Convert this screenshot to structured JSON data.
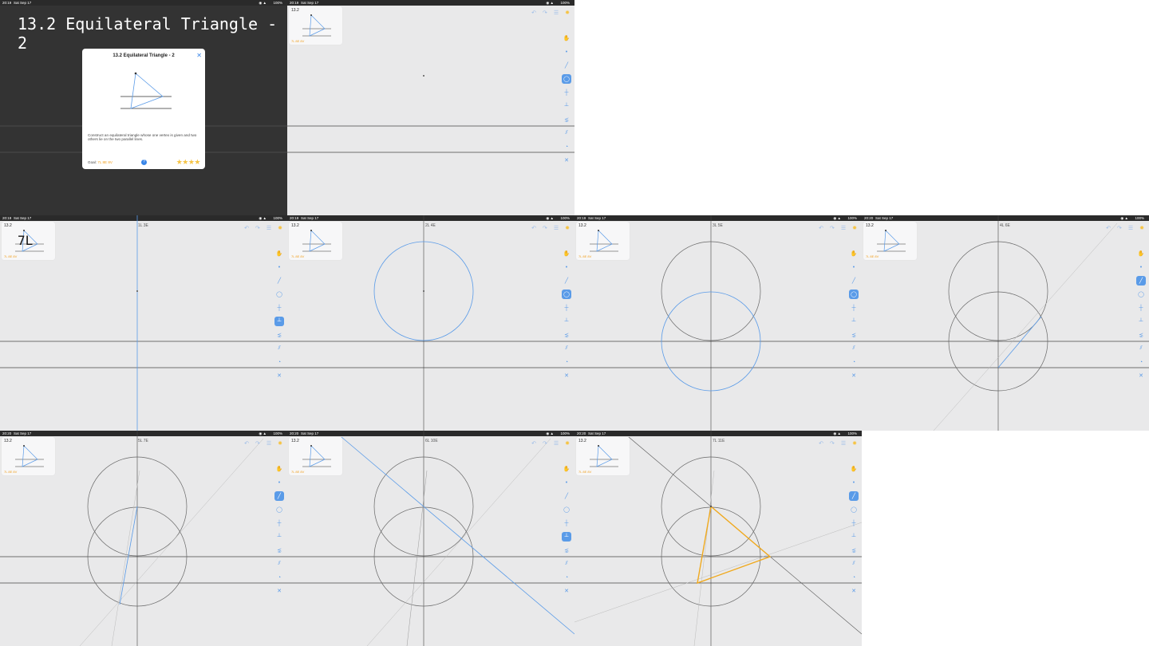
{
  "status": {
    "time_a": "20:19",
    "time_b": "20:20",
    "date": "Sat Sep 17",
    "battery": "100%"
  },
  "title": "13.2 Equilateral Triangle - 2",
  "dialog": {
    "title": "13.2 Equilateral Triangle - 2",
    "description": "Construct an equilateral triangle whose one vertex is given and two others lie on the two parallel lines.",
    "goal_label": "Goal:",
    "goal_value": "7L 8E 8V",
    "stars": "★★★★"
  },
  "thumb": {
    "level": "13.2",
    "goal": "7L 8E 8V"
  },
  "overlay_text": "7L",
  "counters": {
    "p3": "1L 3E",
    "p4": "2L 4E",
    "p5": "3L 5E",
    "p6": "4L 6E",
    "p7": "5L 7E",
    "p8": "6L 10E",
    "p9": "7L 11E"
  },
  "tools": [
    "move",
    "point",
    "line",
    "circle",
    "perpendicular-bisector",
    "perpendicular",
    "angle-bisector",
    "parallel",
    "compass",
    "intersect"
  ],
  "colors": {
    "accent": "#5a9be8",
    "result": "#f0a91d",
    "line": "#3b3b3b",
    "construction": "#6aa5e0"
  }
}
